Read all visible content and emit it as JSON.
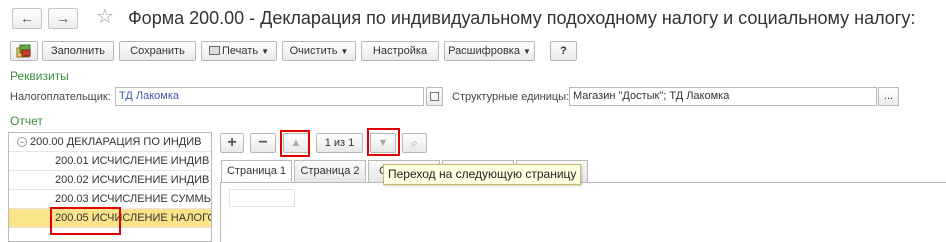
{
  "window": {
    "title": "Форма 200.00 - Декларация по индивидуальному подоходному налогу и социальному налогу:",
    "back_icon": "←",
    "forward_icon": "→",
    "favorite_icon": "☆"
  },
  "toolbar": {
    "fill_label": "Заполнить",
    "save_label": "Сохранить",
    "print_label": "Печать",
    "clear_label": "Очистить",
    "settings_label": "Настройка",
    "decode_label": "Расшифровка",
    "help_label": "?"
  },
  "requisites": {
    "section_label": "Реквизиты",
    "taxpayer_label": "Налогоплательщик:",
    "taxpayer_value": "ТД Лакомка",
    "struct_units_label": "Структурные единицы:",
    "struct_units_value": "Магазин \"Достык\"; ТД Лакомка",
    "more_label": "..."
  },
  "report": {
    "section_label": "Отчет",
    "tree": [
      {
        "label": "200.00 ДЕКЛАРАЦИЯ ПО ИНДИВ",
        "expanded": true
      },
      {
        "label": "200.01 ИСЧИСЛЕНИЕ ИНДИВ"
      },
      {
        "label": "200.02 ИСЧИСЛЕНИЕ ИНДИВ"
      },
      {
        "label": "200.03 ИСЧИСЛЕНИЕ СУММЫ"
      },
      {
        "label": "200.05 ИСЧИСЛЕНИЕ НАЛОГО",
        "selected": true
      }
    ],
    "toolbar": {
      "add_icon": "+",
      "remove_icon": "−",
      "prev_icon": "▲",
      "page_counter": "1 из 1",
      "next_icon": "▼",
      "search_icon": "⌕"
    },
    "tabs": [
      "Страница 1",
      "Страница 2",
      "С"
    ],
    "tooltip": "Переход на следующую страницу"
  },
  "colors": {
    "highlight_red": "#e00000",
    "section_green": "#3b8e3b",
    "selected_row": "#fbe38a"
  }
}
